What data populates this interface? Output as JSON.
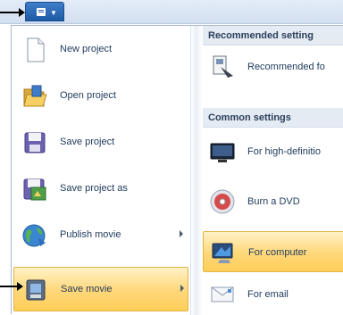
{
  "app_button": {
    "label": "Application menu"
  },
  "left_menu": [
    {
      "label": "New project",
      "has_submenu": false,
      "highlighted": false
    },
    {
      "label": "Open project",
      "has_submenu": false,
      "highlighted": false
    },
    {
      "label": "Save project",
      "has_submenu": false,
      "highlighted": false
    },
    {
      "label": "Save project as",
      "has_submenu": false,
      "highlighted": false
    },
    {
      "label": "Publish movie",
      "has_submenu": true,
      "highlighted": false
    },
    {
      "label": "Save movie",
      "has_submenu": true,
      "highlighted": true
    }
  ],
  "right_menu": {
    "recommended_header": "Recommended setting",
    "recommended_item": "Recommended fo",
    "common_header": "Common settings",
    "items": [
      {
        "label": "For high-definitio",
        "highlighted": false
      },
      {
        "label": "Burn a DVD",
        "highlighted": false
      },
      {
        "label": "For computer",
        "highlighted": true
      },
      {
        "label": "For email",
        "highlighted": false
      }
    ]
  },
  "colors": {
    "highlight": "#ffd779",
    "accent": "#1d5aa5",
    "text": "#1e395b"
  }
}
